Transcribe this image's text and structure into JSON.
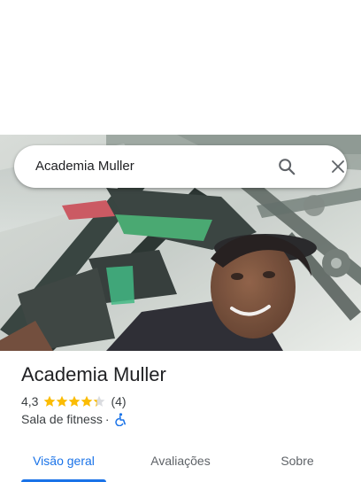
{
  "colors": {
    "accent": "#1a73e8",
    "star": "#fbbc04",
    "text_primary": "#202124",
    "text_secondary": "#5f6368"
  },
  "search": {
    "query": "Academia Muller",
    "search_icon": "search-icon",
    "close_icon": "close-icon"
  },
  "hero": {
    "photo": "selfie-photo-gym"
  },
  "place": {
    "name": "Academia Muller",
    "rating": "4,3",
    "rating_value": 4.3,
    "stars_max": 5,
    "review_count": "(4)",
    "category": "Sala de fitness",
    "separator": "·",
    "accessibility_icon": "wheelchair-accessible-icon"
  },
  "tabs": [
    {
      "label": "Visão geral",
      "active": true
    },
    {
      "label": "Avaliações",
      "active": false
    },
    {
      "label": "Sobre",
      "active": false
    }
  ]
}
